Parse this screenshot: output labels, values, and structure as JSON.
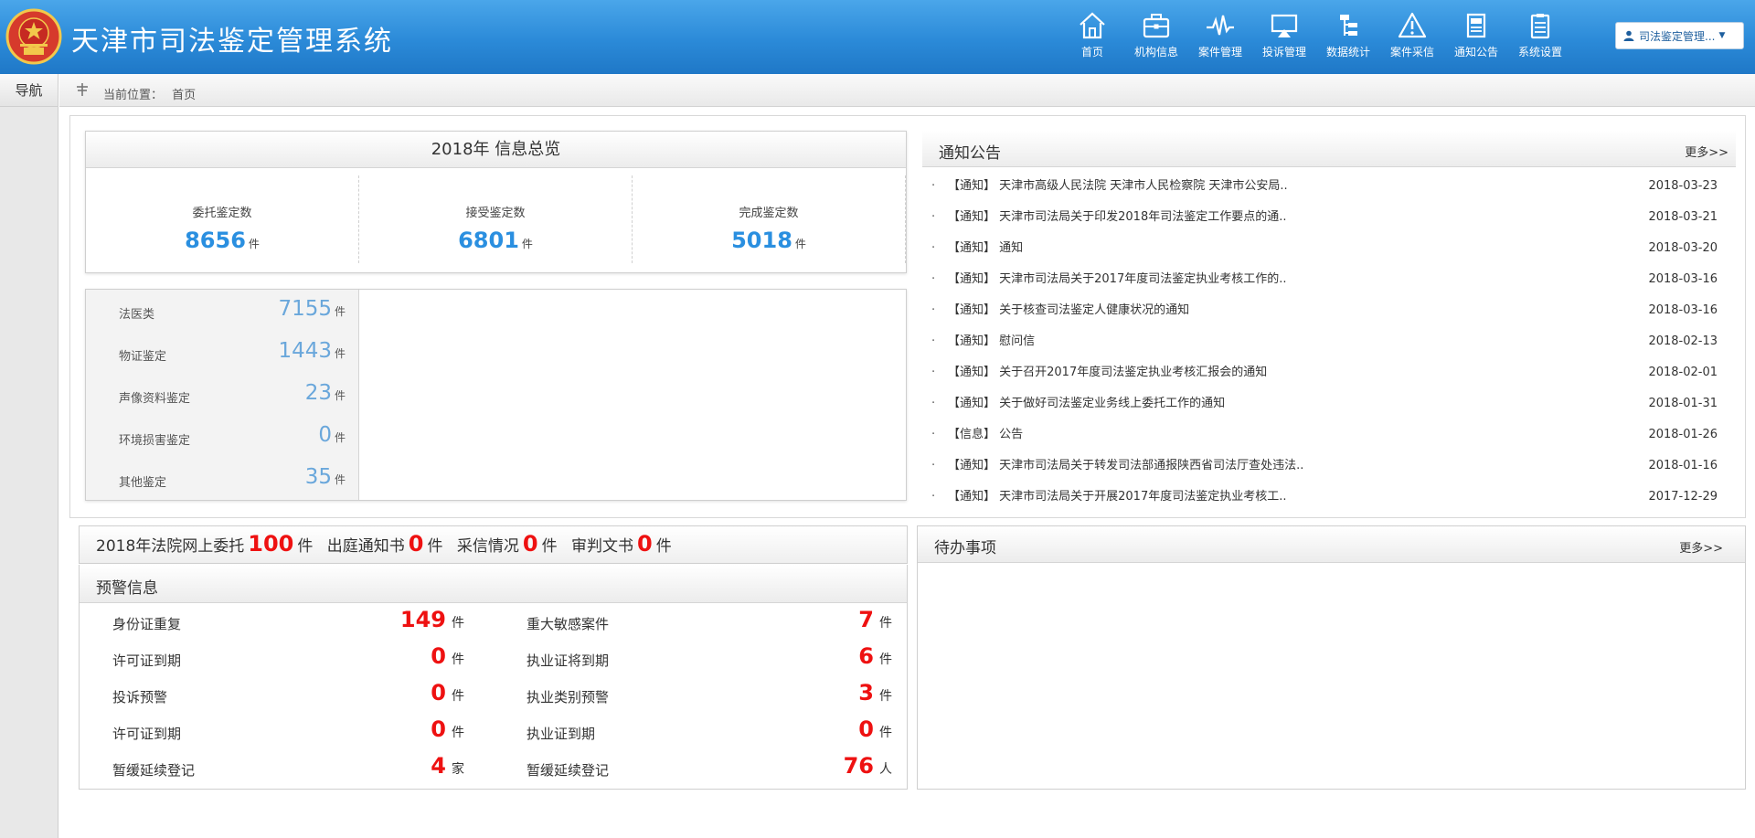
{
  "header": {
    "title": "天津市司法鉴定管理系统",
    "nav": [
      {
        "label": "首页",
        "icon": "home-icon"
      },
      {
        "label": "机构信息",
        "icon": "briefcase-icon"
      },
      {
        "label": "案件管理",
        "icon": "pulse-icon"
      },
      {
        "label": "投诉管理",
        "icon": "monitor-icon"
      },
      {
        "label": "数据统计",
        "icon": "hierarchy-icon"
      },
      {
        "label": "案件采信",
        "icon": "warning-icon"
      },
      {
        "label": "通知公告",
        "icon": "document-icon"
      },
      {
        "label": "系统设置",
        "icon": "clipboard-icon"
      }
    ],
    "user": "司法鉴定管理..."
  },
  "leftnav": {
    "title": "导航"
  },
  "breadcrumb": {
    "label": "当前位置：",
    "page": "首页"
  },
  "overview": {
    "title": "2018年 信息总览",
    "stats": [
      {
        "label": "委托鉴定数",
        "value": "8656",
        "unit": "件"
      },
      {
        "label": "接受鉴定数",
        "value": "6801",
        "unit": "件"
      },
      {
        "label": "完成鉴定数",
        "value": "5018",
        "unit": "件"
      }
    ]
  },
  "categories": [
    {
      "name": "法医类",
      "value": "7155",
      "unit": "件"
    },
    {
      "name": "物证鉴定",
      "value": "1443",
      "unit": "件"
    },
    {
      "name": "声像资料鉴定",
      "value": "23",
      "unit": "件"
    },
    {
      "name": "环境损害鉴定",
      "value": "0",
      "unit": "件"
    },
    {
      "name": "其他鉴定",
      "value": "35",
      "unit": "件"
    }
  ],
  "notices": {
    "title": "通知公告",
    "more": "更多>>",
    "items": [
      {
        "text": "【通知】 天津市高级人民法院 天津市人民检察院 天津市公安局..",
        "date": "2018-03-23"
      },
      {
        "text": "【通知】 天津市司法局关于印发2018年司法鉴定工作要点的通..",
        "date": "2018-03-21"
      },
      {
        "text": "【通知】 通知",
        "date": "2018-03-20"
      },
      {
        "text": "【通知】 天津市司法局关于2017年度司法鉴定执业考核工作的..",
        "date": "2018-03-16"
      },
      {
        "text": "【通知】 关于核查司法鉴定人健康状况的通知",
        "date": "2018-03-16"
      },
      {
        "text": "【通知】 慰问信",
        "date": "2018-02-13"
      },
      {
        "text": "【通知】 关于召开2017年度司法鉴定执业考核汇报会的通知",
        "date": "2018-02-01"
      },
      {
        "text": "【通知】 关于做好司法鉴定业务线上委托工作的通知",
        "date": "2018-01-31"
      },
      {
        "text": "【信息】 公告",
        "date": "2018-01-26"
      },
      {
        "text": "【通知】 天津市司法局关于转发司法部通报陕西省司法厅查处违法..",
        "date": "2018-01-16"
      },
      {
        "text": "【通知】 天津市司法局关于开展2017年度司法鉴定执业考核工..",
        "date": "2017-12-29"
      }
    ]
  },
  "court": {
    "prefix": "2018年法院网上委托",
    "entrust": "100",
    "notice_label": "出庭通知书",
    "notice": "0",
    "adopt_label": "采信情况",
    "adopt": "0",
    "judgment_label": "审判文书",
    "judgment": "0",
    "unit": "件"
  },
  "warnings": {
    "title": "预警信息",
    "left": [
      {
        "label": "身份证重复",
        "value": "149",
        "unit": "件"
      },
      {
        "label": "许可证到期",
        "value": "0",
        "unit": "件"
      },
      {
        "label": "投诉预警",
        "value": "0",
        "unit": "件"
      },
      {
        "label": "许可证到期",
        "value": "0",
        "unit": "件"
      },
      {
        "label": "暂缓延续登记",
        "value": "4",
        "unit": "家"
      }
    ],
    "right": [
      {
        "label": "重大敏感案件",
        "value": "7",
        "unit": "件"
      },
      {
        "label": "执业证将到期",
        "value": "6",
        "unit": "件"
      },
      {
        "label": "执业类别预警",
        "value": "3",
        "unit": "件"
      },
      {
        "label": "执业证到期",
        "value": "0",
        "unit": "件"
      },
      {
        "label": "暂缓延续登记",
        "value": "76",
        "unit": "人"
      }
    ]
  },
  "todo": {
    "title": "待办事项",
    "more": "更多>>"
  },
  "colors": {
    "header_blue": "#2b8ad8",
    "stat_blue": "#2a8fe0",
    "alert_red": "#ee1111",
    "category_blue": "#6aa7db"
  }
}
